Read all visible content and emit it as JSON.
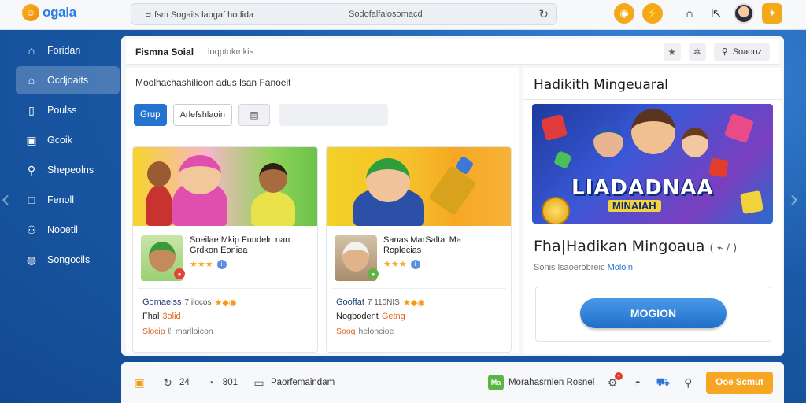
{
  "app": {
    "logo_text": "ogala"
  },
  "topbar": {
    "url_left": "ㅂ fsm Sogails laogaf hodida",
    "url_mid": "Sodofalfalosomacd"
  },
  "sidebar": {
    "items": [
      {
        "label": "Foridan",
        "icon": "home-icon",
        "active": false
      },
      {
        "label": "Ocdjoaits",
        "icon": "home-icon",
        "active": true
      },
      {
        "label": "Poulss",
        "icon": "file-icon",
        "active": false
      },
      {
        "label": "Gcoik",
        "icon": "chart-icon",
        "active": false
      },
      {
        "label": "Shepeolns",
        "icon": "search-icon",
        "active": false
      },
      {
        "label": "Fenoll",
        "icon": "square-icon",
        "active": false
      },
      {
        "label": "Nooetil",
        "icon": "user-icon",
        "active": false
      },
      {
        "label": "Songocils",
        "icon": "shield-icon",
        "active": false
      }
    ]
  },
  "main": {
    "title": "Fismna Soial",
    "subtitle": "loqptokmkis",
    "search_label": "Soaooz",
    "subheading": "Moolhachashilieon adus lsan Fanoeit",
    "chip_primary": "Grup",
    "chip_secondary": "Arlefshlaoin"
  },
  "cards": [
    {
      "title_line1": "Soeilae Mkip Fundeln nan",
      "title_line2": "Grdkon Eoniea",
      "meta_name": "Gomaelss",
      "meta_count": "7 ilocos",
      "meta_line2": "Fhal",
      "meta_line2_accent": "3olid",
      "meta_line3_accent": "Slocip",
      "meta_line3": "ℓ: marlloicon"
    },
    {
      "title_line1": "Sanas MarSaltal Ma",
      "title_line2": "Roplecias",
      "meta_name": "Gooffat",
      "meta_count": "7 110NIS",
      "meta_line2": "Nogbodent",
      "meta_line2_accent": "Getng",
      "meta_line3_accent": "Sooq",
      "meta_line3": "heloncioe"
    }
  ],
  "feature": {
    "title": "Hadikith Mingeuaral",
    "hero_text": "LIADADNAA",
    "hero_sub": "MINAIAH",
    "name": "Fha|Hadikan Mingoaua",
    "name_suffix": "( ⌁ ∕ )",
    "meta": "Sonis lsaoerobreic",
    "meta_link": "Mololn",
    "play_label": "MOGION"
  },
  "bottombar": {
    "count1": "24",
    "count2": "801",
    "label": "Paorfemaindam",
    "green_badge": "Ma",
    "right_label": "Morahasrnien Rosnel",
    "cta_label": "Ooe Scmut"
  },
  "colors": {
    "accent_blue": "#2573cf",
    "accent_orange": "#f6a623",
    "sidebar_bg": "#1b5aa8"
  }
}
